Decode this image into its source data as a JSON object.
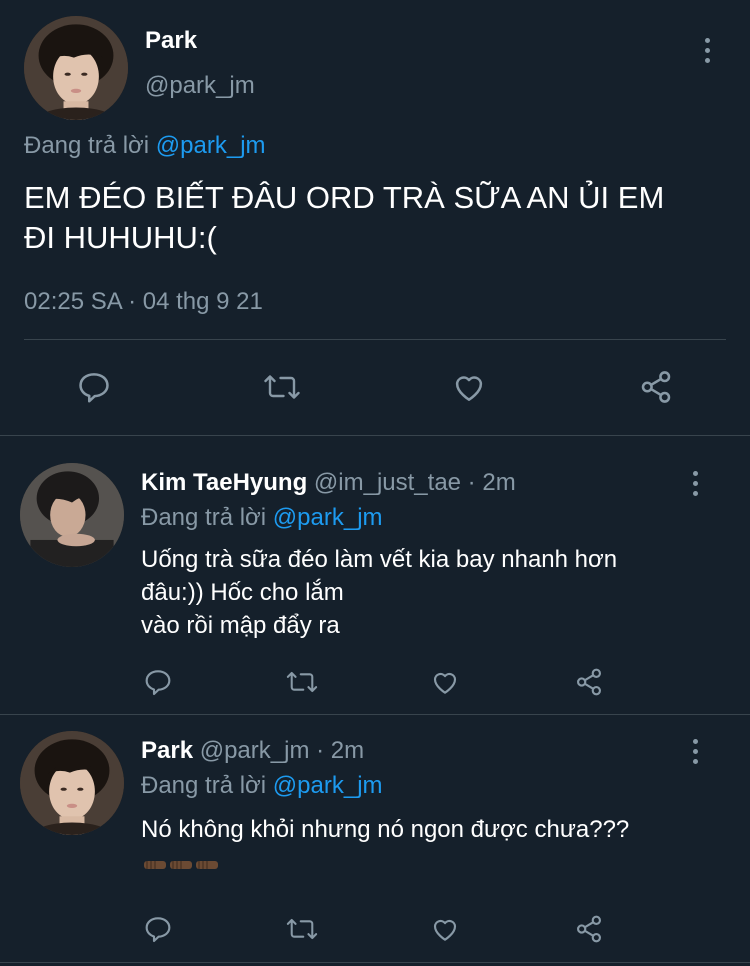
{
  "colors": {
    "background": "#15202b",
    "text": "#ffffff",
    "muted": "#8899a6",
    "link": "#1d9bf0",
    "divider": "#38444d"
  },
  "main_tweet": {
    "display_name": "Park",
    "handle": "@park_jm",
    "reply_prefix": "Đang trả lời",
    "reply_to": "@park_jm",
    "text_line1": "EM ĐÉO BIẾT ĐÂU ORD TRÀ SỮA AN ỦI EM",
    "text_line2": "ĐI HUHUHU:(",
    "timestamp": "02:25 SA · 04 thg 9 21",
    "actions": [
      "reply-icon",
      "retweet-icon",
      "like-icon",
      "share-icon"
    ]
  },
  "replies": [
    {
      "display_name": "Kim TaeHyung",
      "handle_time": "@im_just_tae · 2m",
      "reply_prefix": "Đang trả lời",
      "reply_to": "@park_jm",
      "lines": [
        "Uống trà sữa đéo làm vết kia bay nhanh hơn",
        "đâu:)) Hốc cho lắm",
        "vào rồi mập đẩy ra"
      ]
    },
    {
      "display_name": "Park",
      "handle_time": "@park_jm · 2m",
      "reply_prefix": "Đang trả lời",
      "reply_to": "@park_jm",
      "lines": [
        "Nó không khỏi nhưng nó ngon được chưa???"
      ],
      "emoji": [
        "fist-bump-emoji",
        "fist-bump-emoji",
        "fist-bump-emoji"
      ]
    }
  ]
}
